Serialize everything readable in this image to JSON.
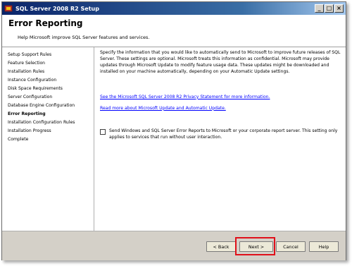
{
  "window": {
    "title": "SQL Server 2008 R2 Setup",
    "controls": [
      "_",
      "□",
      "×"
    ]
  },
  "header": {
    "title": "Error Reporting",
    "subtitle": "Help Microsoft improve SQL Server features and services."
  },
  "sidebar": {
    "items": [
      {
        "label": "Setup Support Rules",
        "active": false
      },
      {
        "label": "Feature Selection",
        "active": false
      },
      {
        "label": "Installation Rules",
        "active": false
      },
      {
        "label": "Instance Configuration",
        "active": false
      },
      {
        "label": "Disk Space Requirements",
        "active": false
      },
      {
        "label": "Server Configuration",
        "active": false
      },
      {
        "label": "Database Engine Configuration",
        "active": false
      },
      {
        "label": "Error Reporting",
        "active": true
      },
      {
        "label": "Installation Configuration Rules",
        "active": false
      },
      {
        "label": "Installation Progress",
        "active": false
      },
      {
        "label": "Complete",
        "active": false
      }
    ]
  },
  "main": {
    "description": "Specify the information that you would like to automatically send to Microsoft to improve future releases of SQL Server. These settings are optional. Microsoft treats this information as confidential. Microsoft may provide updates through Microsoft Update to modify feature usage data. These updates might be downloaded and installed on your machine automatically, depending on your Automatic Update settings.",
    "link_privacy": "See the Microsoft SQL Server 2008 R2 Privacy Statement for more information.",
    "link_update": "Read more about Microsoft Update and Automatic Update.",
    "checkbox_label": "Send Windows and SQL Server Error Reports to Microsoft or your corporate report server. This setting only applies to services that run without user interaction.",
    "checkbox_checked": false
  },
  "buttons": {
    "back": "< Back",
    "next": "Next >",
    "cancel": "Cancel",
    "help": "Help"
  },
  "annotation": {
    "highlight_color": "#e0101a"
  }
}
